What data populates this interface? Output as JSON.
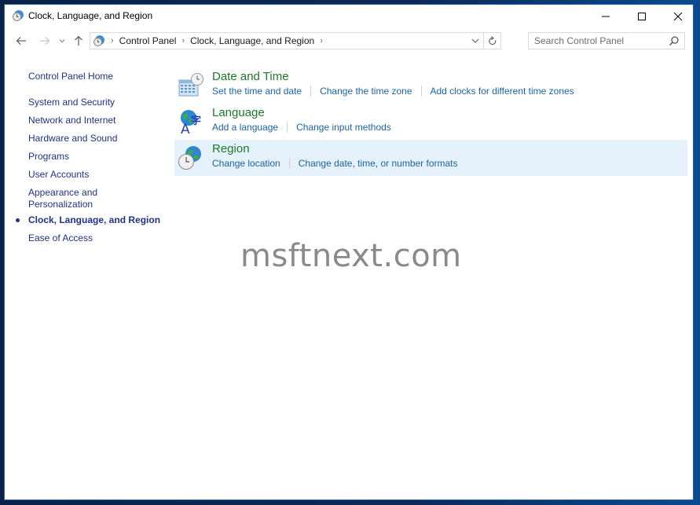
{
  "window": {
    "title": "Clock, Language, and Region",
    "controls": {
      "minimize": "minimize",
      "maximize": "maximize",
      "close": "close"
    }
  },
  "navigation": {
    "breadcrumb": [
      "Control Panel",
      "Clock, Language, and Region"
    ],
    "search_placeholder": "Search Control Panel",
    "search_value": ""
  },
  "sidebar": {
    "home": "Control Panel Home",
    "items": [
      {
        "label": "System and Security",
        "current": false
      },
      {
        "label": "Network and Internet",
        "current": false
      },
      {
        "label": "Hardware and Sound",
        "current": false
      },
      {
        "label": "Programs",
        "current": false
      },
      {
        "label": "User Accounts",
        "current": false
      },
      {
        "label": "Appearance and Personalization",
        "current": false
      },
      {
        "label": "Clock, Language, and Region",
        "current": true
      },
      {
        "label": "Ease of Access",
        "current": false
      }
    ]
  },
  "categories": [
    {
      "title": "Date and Time",
      "icon": "calendar-clock-icon",
      "links": [
        "Set the time and date",
        "Change the time zone",
        "Add clocks for different time zones"
      ]
    },
    {
      "title": "Language",
      "icon": "language-globe-icon",
      "links": [
        "Add a language",
        "Change input methods"
      ]
    },
    {
      "title": "Region",
      "icon": "globe-clock-icon",
      "highlighted": true,
      "links": [
        "Change location",
        "Change date, time, or number formats"
      ]
    }
  ],
  "watermark": "msftnext.com",
  "colors": {
    "link": "#1b63a6",
    "category_title": "#1a7a26",
    "sidebar_link": "#1e3287",
    "highlight": "#e5f1fb"
  }
}
